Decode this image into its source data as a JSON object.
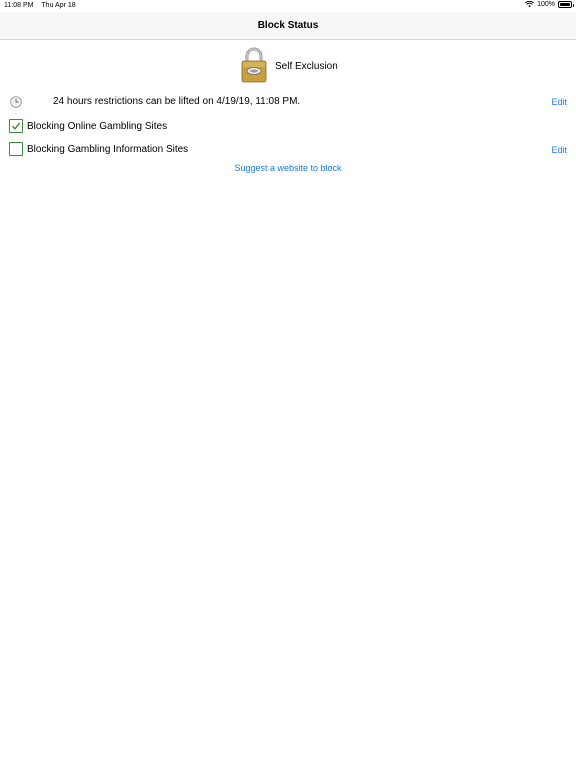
{
  "status_bar": {
    "time": "11:08 PM",
    "date": "Thu Apr 18",
    "battery": "100%"
  },
  "nav": {
    "title": "Block Status"
  },
  "header": {
    "title": "Self Exclusion"
  },
  "restriction": {
    "text": "24 hours restrictions can be lifted on 4/19/19, 11:08 PM.",
    "edit_label": "Edit"
  },
  "items": [
    {
      "label": "Blocking Online Gambling Sites",
      "checked": true
    },
    {
      "label": "Blocking Gambling Information Sites",
      "checked": false,
      "edit_label": "Edit"
    }
  ],
  "suggest_link": "Suggest a website to block",
  "colors": {
    "link": "#1a7ae6",
    "check": "#3a8a3a",
    "lock_body": "#c8a040"
  },
  "icons": [
    "wifi-icon",
    "battery-icon",
    "lock-icon",
    "clock-icon",
    "checkmark-icon"
  ]
}
